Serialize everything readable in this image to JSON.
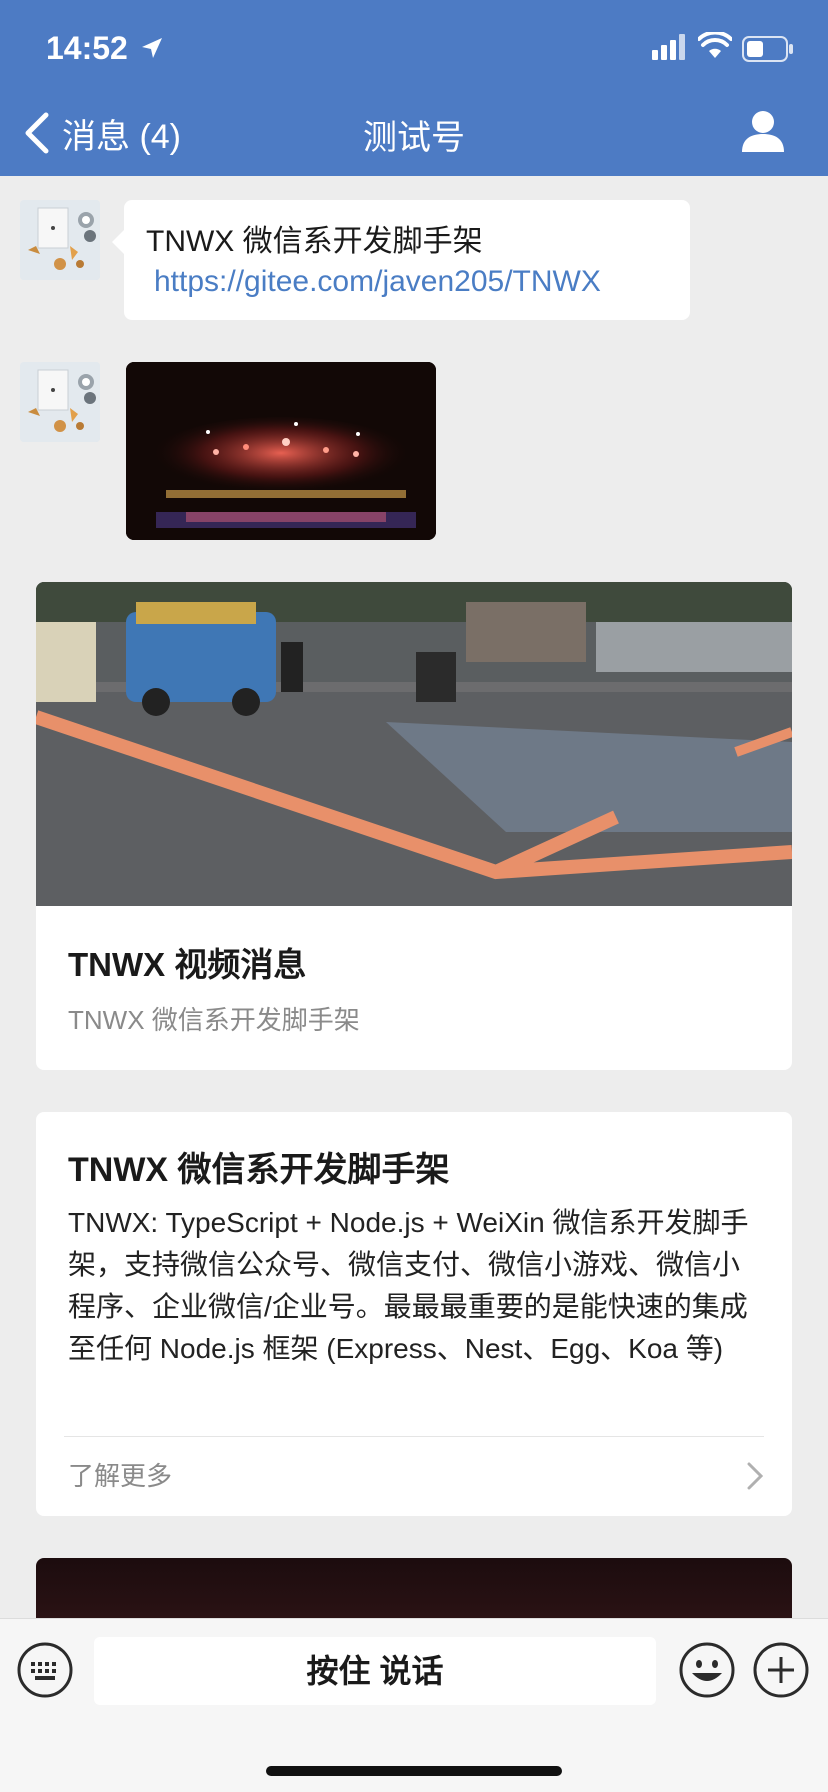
{
  "status_bar": {
    "time": "14:52"
  },
  "nav": {
    "back_label": "消息 (4)",
    "title": "测试号"
  },
  "messages": {
    "text_line1": "TNWX 微信系开发脚手架",
    "text_link": "https://gitee.com/javen205/TNWX"
  },
  "video_card": {
    "title": "TNWX 视频消息",
    "description": "TNWX 微信系开发脚手架"
  },
  "article_card": {
    "title": "TNWX 微信系开发脚手架",
    "body": "TNWX: TypeScript + Node.js + WeiXin 微信系开发脚手架，支持微信公众号、微信支付、微信小游戏、微信小程序、企业微信/企业号。最最最重要的是能快速的集成至任何 Node.js 框架 (Express、Nest、Egg、Koa 等)",
    "read_more": "了解更多"
  },
  "input_bar": {
    "hold_to_talk": "按住 说话"
  },
  "icons": {
    "back": "chevron-left-icon",
    "profile": "person-icon",
    "keyboard": "keyboard-icon",
    "emoji": "emoji-icon",
    "plus": "plus-icon"
  },
  "colors": {
    "header_bg": "#4d7bc4",
    "link": "#4a7dc4",
    "page_bg": "#ededed"
  }
}
